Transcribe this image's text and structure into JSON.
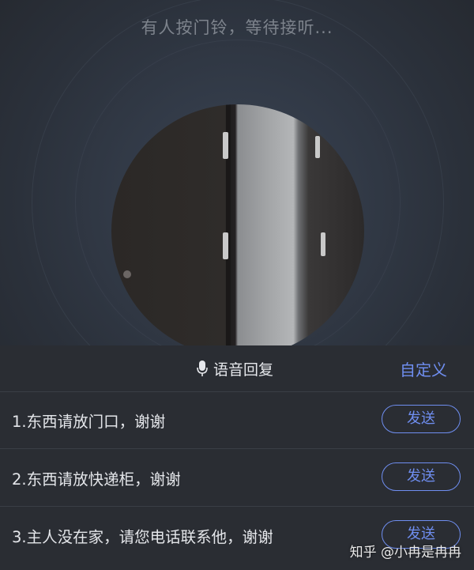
{
  "status_text": "有人按门铃，等待接听...",
  "panel": {
    "voice_reply_label": "语音回复",
    "custom_label": "自定义"
  },
  "replies": [
    {
      "text": "1.东西请放门口，谢谢",
      "send_label": "发送"
    },
    {
      "text": "2.东西请放快递柜，谢谢",
      "send_label": "发送"
    },
    {
      "text": "3.主人没在家，请您电话联系他，谢谢",
      "send_label": "发送"
    }
  ],
  "watermark": "知乎 @小冉是冉冉",
  "colors": {
    "accent": "#6f8ef0",
    "panel_bg": "#2a2d33",
    "divider": "#3a3e45",
    "text_primary": "#e4e6ea",
    "text_muted": "#7d838c"
  },
  "icons": {
    "voice": "microphone-icon"
  }
}
